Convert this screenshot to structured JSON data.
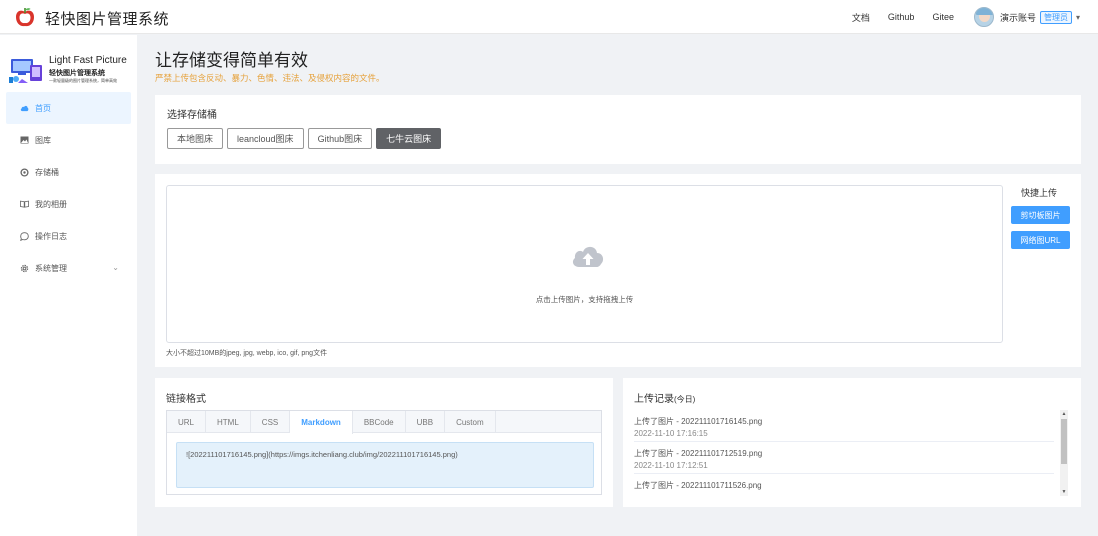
{
  "header": {
    "app_title": "轻快图片管理系统",
    "links": [
      "文档",
      "Github",
      "Gitee"
    ],
    "user_name": "演示账号",
    "role_badge": "管理员",
    "dropdown_caret": "▾"
  },
  "brand": {
    "en": "Light Fast Picture",
    "cn": "轻快图片管理系统",
    "sub": "一款轻量级的图片管理系统，简单高效"
  },
  "sidebar": {
    "items": [
      {
        "label": "首页",
        "icon": "cloud-icon",
        "active": true
      },
      {
        "label": "图库",
        "icon": "image-icon",
        "active": false
      },
      {
        "label": "存储桶",
        "icon": "bucket-icon",
        "active": false
      },
      {
        "label": "我的相册",
        "icon": "book-icon",
        "active": false
      },
      {
        "label": "操作日志",
        "icon": "chat-icon",
        "active": false
      },
      {
        "label": "系统管理",
        "icon": "gear-icon",
        "active": false
      }
    ],
    "chevron": "⌄"
  },
  "page": {
    "title": "让存储变得简单有效",
    "warning": "严禁上传包含反动、暴力、色情、违法、及侵权内容的文件。"
  },
  "bucket": {
    "title": "选择存储桶",
    "options": [
      "本地图床",
      "leancloud图床",
      "Github图床",
      "七牛云图床"
    ],
    "selected": "七牛云图床"
  },
  "upload": {
    "drop_text": "点击上传图片，支持拖拽上传",
    "size_hint": "大小不超过10MB的jpeg, jpg, webp, ico, gif, png文件",
    "quick_title": "快捷上传",
    "clipboard_button": "剪切板图片",
    "url_button": "网络图URL"
  },
  "link_format": {
    "title": "链接格式",
    "tabs": [
      "URL",
      "HTML",
      "CSS",
      "Markdown",
      "BBCode",
      "UBB",
      "Custom"
    ],
    "active_tab": "Markdown",
    "code": "![202211101716145.png](https://imgs.itchenliang.club/img/202211101716145.png)"
  },
  "history": {
    "title": "上传记录",
    "title_suffix": "(今日)",
    "items": [
      {
        "name": "上传了图片 - 202211101716145.png",
        "time": "2022-11-10 17:16:15"
      },
      {
        "name": "上传了图片 - 202211101712519.png",
        "time": "2022-11-10 17:12:51"
      },
      {
        "name": "上传了图片 - 202211101711526.png",
        "time": ""
      }
    ]
  },
  "colors": {
    "accent": "#409eff",
    "warning": "#e6a23c",
    "active_bucket": "#606266",
    "logo_red": "#d9342b"
  }
}
